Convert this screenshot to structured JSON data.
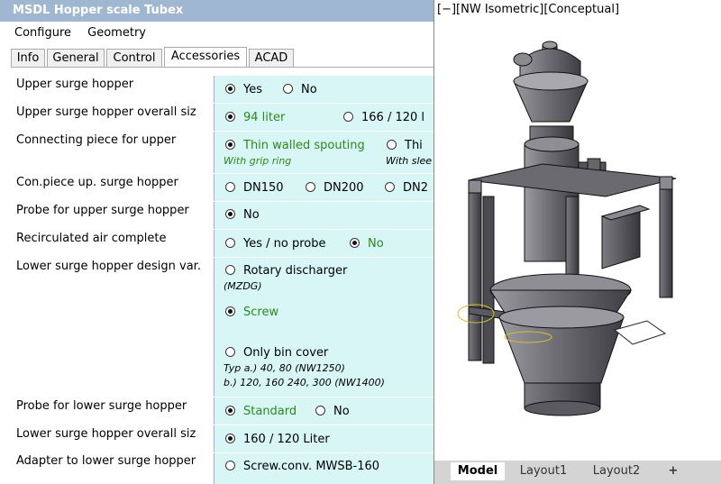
{
  "window": {
    "title": "MSDL Hopper scale Tubex"
  },
  "menu": [
    "Configure",
    "Geometry"
  ],
  "tabs": [
    "Info",
    "General",
    "Control",
    "Accessories",
    "ACAD"
  ],
  "active_tab": "Accessories",
  "rows": [
    {
      "label": "Upper surge hopper",
      "options": [
        {
          "text": "Yes",
          "selected": true
        },
        {
          "text": "No",
          "selected": false
        }
      ]
    },
    {
      "label": "Upper surge hopper overall siz",
      "options": [
        {
          "text": "94 liter",
          "selected": true
        },
        {
          "text": "166 / 120 l",
          "selected": false
        }
      ]
    },
    {
      "label": "Connecting piece for upper",
      "options": [
        {
          "text": "Thin walled spouting",
          "selected": true,
          "note": "With grip ring"
        },
        {
          "text": "Thi",
          "selected": false,
          "note": "With slee"
        }
      ]
    },
    {
      "label": "Con.piece up. surge hopper",
      "options": [
        {
          "text": "DN150",
          "selected": false
        },
        {
          "text": "DN200",
          "selected": false
        },
        {
          "text": "DN2",
          "selected": false
        }
      ]
    },
    {
      "label": "Probe for upper surge hopper",
      "options": [
        {
          "text": "No",
          "selected": true
        }
      ]
    },
    {
      "label": "Recirculated air complete",
      "options": [
        {
          "text": "Yes / no probe",
          "selected": false
        },
        {
          "text": "No",
          "selected": true
        }
      ]
    },
    {
      "label": "Lower surge hopper design var.",
      "options": [
        {
          "text": "Rotary discharger",
          "selected": false,
          "note": "(MZDG)"
        },
        {
          "text": "Screw",
          "selected": true
        },
        {
          "text": "Only bin cover",
          "selected": false,
          "note": "Typ a.) 40, 80 (NW1250)",
          "note2": "b.) 120, 160 240, 300 (NW1400)"
        }
      ]
    },
    {
      "label": "Probe for lower surge hopper",
      "options": [
        {
          "text": "Standard",
          "selected": true
        },
        {
          "text": "No",
          "selected": false
        }
      ]
    },
    {
      "label": "Lower surge hopper overall siz",
      "options": [
        {
          "text": "160 / 120 Liter",
          "selected": true
        }
      ]
    },
    {
      "label": "Adapter to lower surge hopper",
      "options": [
        {
          "text": "Screw.conv. MWSB-160",
          "selected": false
        }
      ]
    }
  ],
  "viewport": {
    "label": "[−][NW Isometric][Conceptual]",
    "layout_tabs": [
      "Model",
      "Layout1",
      "Layout2",
      "+"
    ],
    "active_layout": "Model"
  },
  "colors": {
    "title_bar": "#9fb7d0",
    "value_bg": "#d8f6f6",
    "selected_text": "#2a8a1a",
    "model_gray": "#6e6e72"
  }
}
